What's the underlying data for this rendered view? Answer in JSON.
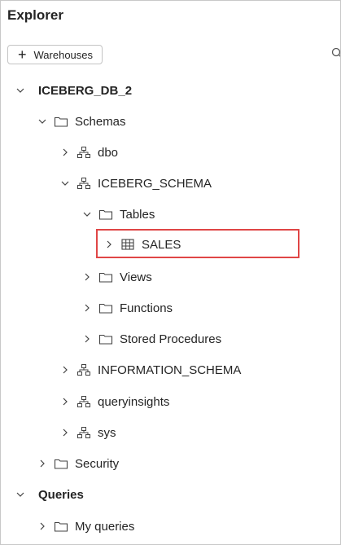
{
  "panel": {
    "title": "Explorer",
    "add_button_label": "Warehouses",
    "add_button_icon": "plus-icon",
    "search_icon": "search-icon"
  },
  "tree": {
    "database": "ICEBERG_DB_2",
    "schemas_folder": "Schemas",
    "schema_dbo": "dbo",
    "schema_iceberg": "ICEBERG_SCHEMA",
    "tables_folder": "Tables",
    "table_sales": "SALES",
    "views_folder": "Views",
    "functions_folder": "Functions",
    "stored_procedures_folder": "Stored Procedures",
    "schema_information": "INFORMATION_SCHEMA",
    "schema_queryinsights": "queryinsights",
    "schema_sys": "sys",
    "security_folder": "Security",
    "queries_section": "Queries",
    "my_queries_folder": "My queries"
  },
  "colors": {
    "highlight_border": "#e04646",
    "text": "#242424"
  }
}
